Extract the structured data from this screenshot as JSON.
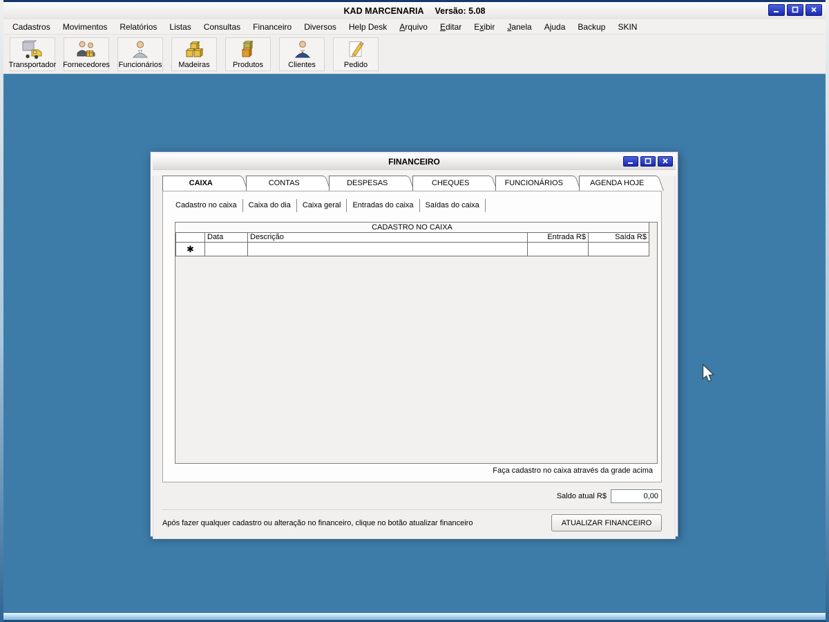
{
  "window": {
    "title": "KAD MARCENARIA",
    "version_label": "Versão: 5.08",
    "controls": [
      "minimize",
      "maximize",
      "close"
    ]
  },
  "menubar": {
    "items": [
      {
        "label": "Cadastros"
      },
      {
        "label": "Movimentos"
      },
      {
        "label": "Relatórios"
      },
      {
        "label": "Listas"
      },
      {
        "label": "Consultas"
      },
      {
        "label": "Financeiro"
      },
      {
        "label": "Diversos"
      },
      {
        "label": "Help Desk"
      },
      {
        "label": "Arquivo",
        "underline": 0
      },
      {
        "label": "Editar",
        "underline": 0
      },
      {
        "label": "Exibir",
        "underline": 1
      },
      {
        "label": "Janela",
        "underline": 0
      },
      {
        "label": "Ajuda"
      },
      {
        "label": "Backup"
      },
      {
        "label": "SKIN"
      }
    ]
  },
  "toolbar": {
    "buttons": [
      {
        "label": "Transportador",
        "icon": "truck-icon"
      },
      {
        "label": "Fornecedores",
        "icon": "suppliers-icon"
      },
      {
        "label": "Funcionários",
        "icon": "employee-icon"
      },
      {
        "label": "Madeiras",
        "icon": "wood-boxes-icon"
      },
      {
        "label": "Produtos",
        "icon": "product-boxes-icon"
      },
      {
        "label": "Clientes",
        "icon": "client-icon"
      },
      {
        "label": "Pedido",
        "icon": "order-pencil-icon"
      }
    ]
  },
  "financeiro_window": {
    "title": "FINANCEIRO",
    "controls": [
      "minimize",
      "maximize",
      "close"
    ],
    "tabs": [
      {
        "label": "CAIXA",
        "active": true
      },
      {
        "label": "CONTAS",
        "active": false
      },
      {
        "label": "DESPESAS",
        "active": false
      },
      {
        "label": "CHEQUES",
        "active": false
      },
      {
        "label": "FUNCIONÁRIOS",
        "active": false
      },
      {
        "label": "AGENDA HOJE",
        "active": false
      }
    ],
    "subtabs": [
      {
        "label": "Cadastro no caixa",
        "active": true
      },
      {
        "label": "Caixa do dia",
        "active": false
      },
      {
        "label": "Caixa geral",
        "active": false
      },
      {
        "label": "Entradas do caixa",
        "active": false
      },
      {
        "label": "Saídas do caixa",
        "active": false
      }
    ],
    "grid": {
      "caption": "CADASTRO NO CAIXA",
      "columns": [
        "",
        "Data",
        "Descrição",
        "Entrada R$",
        "Saída R$"
      ],
      "new_row_marker": "✱",
      "rows": []
    },
    "hint": "Faça cadastro no caixa através da grade acima",
    "saldo": {
      "label": "Saldo atual R$",
      "value": "0,00"
    },
    "footer_note": "Após fazer qualquer cadastro ou alteração no financeiro, clique no botão atualizar financeiro",
    "update_button": "ATUALIZAR FINANCEIRO"
  },
  "colors": {
    "desktop": "#3d7ca8",
    "window_button_blue": "#1b28b0",
    "frame_navy": "#16386e",
    "chrome_gray": "#f0efed"
  }
}
